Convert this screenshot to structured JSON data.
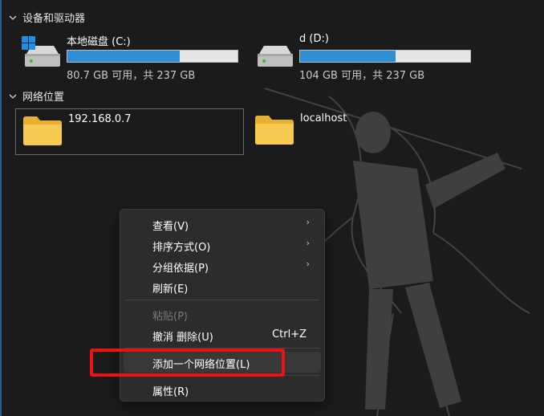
{
  "sections": {
    "devices_header": "设备和驱动器",
    "network_header": "网络位置"
  },
  "drives": [
    {
      "name": "本地磁盘 (C:)",
      "space": "80.7 GB 可用，共 237 GB",
      "used_fraction": 0.66,
      "has_windows_logo": true
    },
    {
      "name": "d (D:)",
      "space": "104 GB 可用，共 237 GB",
      "used_fraction": 0.56,
      "has_windows_logo": false
    }
  ],
  "network_locations": [
    {
      "label": "192.168.0.7",
      "selected": true
    },
    {
      "label": "localhost",
      "selected": false
    }
  ],
  "context_menu": {
    "items": [
      {
        "label": "查看(V)",
        "submenu": true
      },
      {
        "label": "排序方式(O)",
        "submenu": true
      },
      {
        "label": "分组依据(P)",
        "submenu": true
      },
      {
        "label": "刷新(E)"
      },
      {
        "label": "粘贴(P)",
        "disabled": true
      },
      {
        "label": "撤消 删除(U)",
        "shortcut": "Ctrl+Z"
      },
      {
        "label": "添加一个网络位置(L)",
        "highlighted": true
      },
      {
        "label": "属性(R)"
      }
    ],
    "submenu_arrow": "›"
  },
  "colors": {
    "background": "#1b1b1b",
    "bar_fill": "#2e8fd6",
    "highlight_box": "#ee1111",
    "folder": "#f4c542"
  },
  "icons": {
    "drive": "hard-drive-icon",
    "folder": "folder-icon",
    "chevron": "chevron-down-icon",
    "windows": "windows-logo-icon"
  }
}
